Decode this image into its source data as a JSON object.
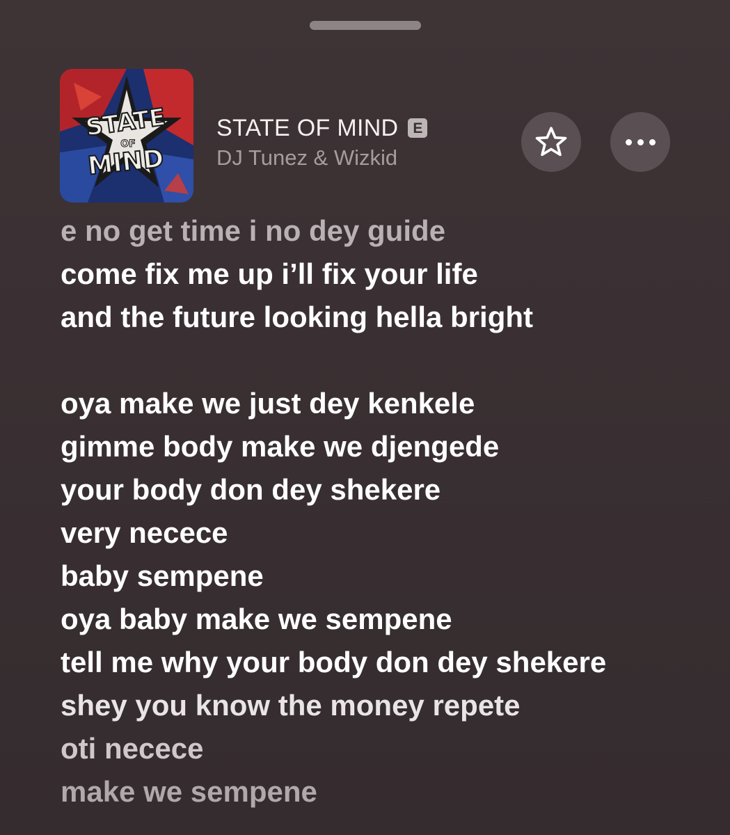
{
  "now_playing": {
    "title": "STATE OF MIND",
    "explicit_badge": "E",
    "artist": "DJ Tunez & Wizkid",
    "artwork_text_line1": "STATE",
    "artwork_text_line2": "OF",
    "artwork_text_line3": "MIND",
    "actions": [
      {
        "name": "favorite",
        "icon": "star-outline-icon"
      },
      {
        "name": "more",
        "icon": "ellipsis-icon"
      }
    ]
  },
  "lyrics": [
    "e no get time i no dey guide",
    "come fix me up i’ll fix your life",
    "and the future looking hella bright",
    "",
    "oya make we just dey kenkele",
    "gimme body make we djengede",
    "your body don dey shekere",
    "very necece",
    "baby sempene",
    "oya baby make we sempene",
    "tell me why your body don dey shekere",
    "shey you know the money repete",
    "oti necece",
    "make we sempene"
  ],
  "colors": {
    "background": "#3a3033",
    "lyric_active": "#ffffff",
    "artist_text": "#a59c9e",
    "button_bg": "#5a4f52"
  }
}
